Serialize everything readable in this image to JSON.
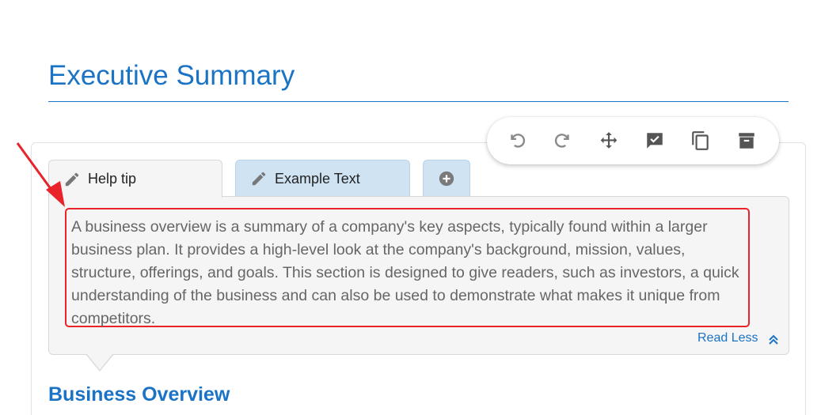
{
  "page": {
    "title": "Executive Summary",
    "subheading": "Business Overview"
  },
  "toolbar": {
    "buttons": [
      {
        "name": "undo-icon"
      },
      {
        "name": "redo-icon"
      },
      {
        "name": "move-icon"
      },
      {
        "name": "approve-icon"
      },
      {
        "name": "copy-icon"
      },
      {
        "name": "archive-icon"
      }
    ]
  },
  "tabs": [
    {
      "label": "Help tip",
      "icon": "pencil-icon",
      "active": true
    },
    {
      "label": "Example Text",
      "icon": "pencil-icon",
      "active": false
    },
    {
      "label": "",
      "icon": "add-circle-icon",
      "active": false
    }
  ],
  "tip": {
    "text": "A business overview is a summary of a company's key aspects, typically found within a larger business plan. It provides a high-level look at the company's background, mission, values, structure, offerings, and goals. This section is designed to give readers, such as investors, a quick understanding of the business and can also be used to demonstrate what makes it unique from competitors.",
    "read_less_label": "Read Less"
  },
  "colors": {
    "accent": "#1a73c4",
    "highlight": "#e8232a",
    "tab_inactive": "#cfe3f3",
    "panel": "#f5f5f5"
  }
}
